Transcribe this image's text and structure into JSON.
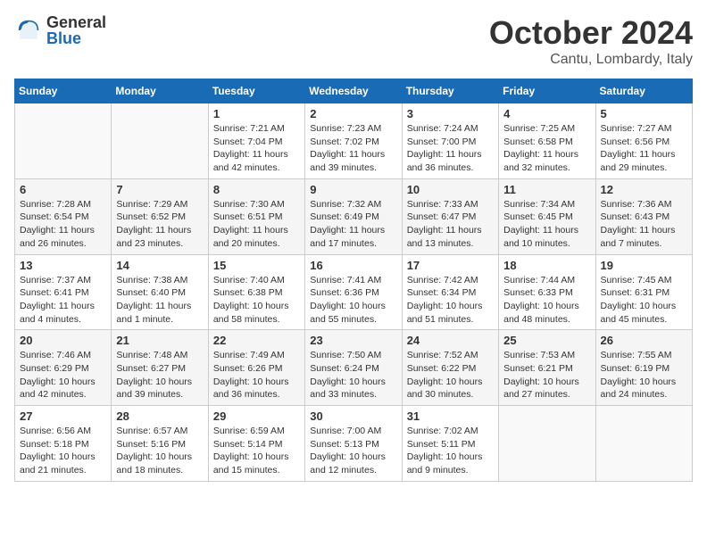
{
  "logo": {
    "general": "General",
    "blue": "Blue"
  },
  "title": {
    "month": "October 2024",
    "location": "Cantu, Lombardy, Italy"
  },
  "weekdays": [
    "Sunday",
    "Monday",
    "Tuesday",
    "Wednesday",
    "Thursday",
    "Friday",
    "Saturday"
  ],
  "weeks": [
    [
      {
        "day": "",
        "info": ""
      },
      {
        "day": "",
        "info": ""
      },
      {
        "day": "1",
        "sunrise": "Sunrise: 7:21 AM",
        "sunset": "Sunset: 7:04 PM",
        "daylight": "Daylight: 11 hours and 42 minutes."
      },
      {
        "day": "2",
        "sunrise": "Sunrise: 7:23 AM",
        "sunset": "Sunset: 7:02 PM",
        "daylight": "Daylight: 11 hours and 39 minutes."
      },
      {
        "day": "3",
        "sunrise": "Sunrise: 7:24 AM",
        "sunset": "Sunset: 7:00 PM",
        "daylight": "Daylight: 11 hours and 36 minutes."
      },
      {
        "day": "4",
        "sunrise": "Sunrise: 7:25 AM",
        "sunset": "Sunset: 6:58 PM",
        "daylight": "Daylight: 11 hours and 32 minutes."
      },
      {
        "day": "5",
        "sunrise": "Sunrise: 7:27 AM",
        "sunset": "Sunset: 6:56 PM",
        "daylight": "Daylight: 11 hours and 29 minutes."
      }
    ],
    [
      {
        "day": "6",
        "sunrise": "Sunrise: 7:28 AM",
        "sunset": "Sunset: 6:54 PM",
        "daylight": "Daylight: 11 hours and 26 minutes."
      },
      {
        "day": "7",
        "sunrise": "Sunrise: 7:29 AM",
        "sunset": "Sunset: 6:52 PM",
        "daylight": "Daylight: 11 hours and 23 minutes."
      },
      {
        "day": "8",
        "sunrise": "Sunrise: 7:30 AM",
        "sunset": "Sunset: 6:51 PM",
        "daylight": "Daylight: 11 hours and 20 minutes."
      },
      {
        "day": "9",
        "sunrise": "Sunrise: 7:32 AM",
        "sunset": "Sunset: 6:49 PM",
        "daylight": "Daylight: 11 hours and 17 minutes."
      },
      {
        "day": "10",
        "sunrise": "Sunrise: 7:33 AM",
        "sunset": "Sunset: 6:47 PM",
        "daylight": "Daylight: 11 hours and 13 minutes."
      },
      {
        "day": "11",
        "sunrise": "Sunrise: 7:34 AM",
        "sunset": "Sunset: 6:45 PM",
        "daylight": "Daylight: 11 hours and 10 minutes."
      },
      {
        "day": "12",
        "sunrise": "Sunrise: 7:36 AM",
        "sunset": "Sunset: 6:43 PM",
        "daylight": "Daylight: 11 hours and 7 minutes."
      }
    ],
    [
      {
        "day": "13",
        "sunrise": "Sunrise: 7:37 AM",
        "sunset": "Sunset: 6:41 PM",
        "daylight": "Daylight: 11 hours and 4 minutes."
      },
      {
        "day": "14",
        "sunrise": "Sunrise: 7:38 AM",
        "sunset": "Sunset: 6:40 PM",
        "daylight": "Daylight: 11 hours and 1 minute."
      },
      {
        "day": "15",
        "sunrise": "Sunrise: 7:40 AM",
        "sunset": "Sunset: 6:38 PM",
        "daylight": "Daylight: 10 hours and 58 minutes."
      },
      {
        "day": "16",
        "sunrise": "Sunrise: 7:41 AM",
        "sunset": "Sunset: 6:36 PM",
        "daylight": "Daylight: 10 hours and 55 minutes."
      },
      {
        "day": "17",
        "sunrise": "Sunrise: 7:42 AM",
        "sunset": "Sunset: 6:34 PM",
        "daylight": "Daylight: 10 hours and 51 minutes."
      },
      {
        "day": "18",
        "sunrise": "Sunrise: 7:44 AM",
        "sunset": "Sunset: 6:33 PM",
        "daylight": "Daylight: 10 hours and 48 minutes."
      },
      {
        "day": "19",
        "sunrise": "Sunrise: 7:45 AM",
        "sunset": "Sunset: 6:31 PM",
        "daylight": "Daylight: 10 hours and 45 minutes."
      }
    ],
    [
      {
        "day": "20",
        "sunrise": "Sunrise: 7:46 AM",
        "sunset": "Sunset: 6:29 PM",
        "daylight": "Daylight: 10 hours and 42 minutes."
      },
      {
        "day": "21",
        "sunrise": "Sunrise: 7:48 AM",
        "sunset": "Sunset: 6:27 PM",
        "daylight": "Daylight: 10 hours and 39 minutes."
      },
      {
        "day": "22",
        "sunrise": "Sunrise: 7:49 AM",
        "sunset": "Sunset: 6:26 PM",
        "daylight": "Daylight: 10 hours and 36 minutes."
      },
      {
        "day": "23",
        "sunrise": "Sunrise: 7:50 AM",
        "sunset": "Sunset: 6:24 PM",
        "daylight": "Daylight: 10 hours and 33 minutes."
      },
      {
        "day": "24",
        "sunrise": "Sunrise: 7:52 AM",
        "sunset": "Sunset: 6:22 PM",
        "daylight": "Daylight: 10 hours and 30 minutes."
      },
      {
        "day": "25",
        "sunrise": "Sunrise: 7:53 AM",
        "sunset": "Sunset: 6:21 PM",
        "daylight": "Daylight: 10 hours and 27 minutes."
      },
      {
        "day": "26",
        "sunrise": "Sunrise: 7:55 AM",
        "sunset": "Sunset: 6:19 PM",
        "daylight": "Daylight: 10 hours and 24 minutes."
      }
    ],
    [
      {
        "day": "27",
        "sunrise": "Sunrise: 6:56 AM",
        "sunset": "Sunset: 5:18 PM",
        "daylight": "Daylight: 10 hours and 21 minutes."
      },
      {
        "day": "28",
        "sunrise": "Sunrise: 6:57 AM",
        "sunset": "Sunset: 5:16 PM",
        "daylight": "Daylight: 10 hours and 18 minutes."
      },
      {
        "day": "29",
        "sunrise": "Sunrise: 6:59 AM",
        "sunset": "Sunset: 5:14 PM",
        "daylight": "Daylight: 10 hours and 15 minutes."
      },
      {
        "day": "30",
        "sunrise": "Sunrise: 7:00 AM",
        "sunset": "Sunset: 5:13 PM",
        "daylight": "Daylight: 10 hours and 12 minutes."
      },
      {
        "day": "31",
        "sunrise": "Sunrise: 7:02 AM",
        "sunset": "Sunset: 5:11 PM",
        "daylight": "Daylight: 10 hours and 9 minutes."
      },
      {
        "day": "",
        "info": ""
      },
      {
        "day": "",
        "info": ""
      }
    ]
  ]
}
